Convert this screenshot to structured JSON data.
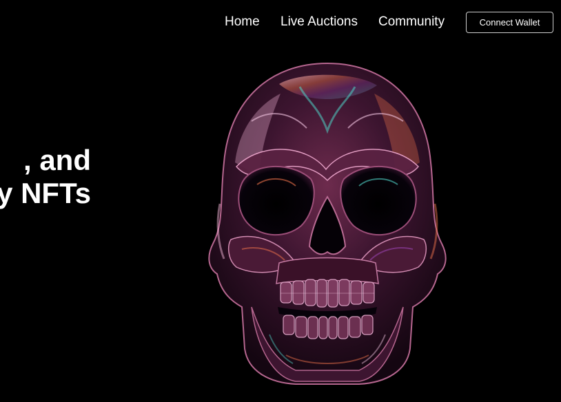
{
  "nav": {
    "links": [
      {
        "label": "Home"
      },
      {
        "label": "Live Auctions"
      },
      {
        "label": "Community"
      }
    ],
    "connect_wallet_label": "Connect Wallet"
  },
  "hero": {
    "title_lines": [
      ", and",
      "y NFTs"
    ],
    "image": {
      "subject": "iridescent-chrome-skull",
      "colors": {
        "base": "#2a0f1e",
        "highlight": "#f4c6e2",
        "accent_orange": "#e8704a",
        "accent_teal": "#4fd1c5",
        "accent_purple": "#8a3c9a"
      }
    }
  },
  "theme": {
    "background": "#000000",
    "text": "#ffffff"
  }
}
